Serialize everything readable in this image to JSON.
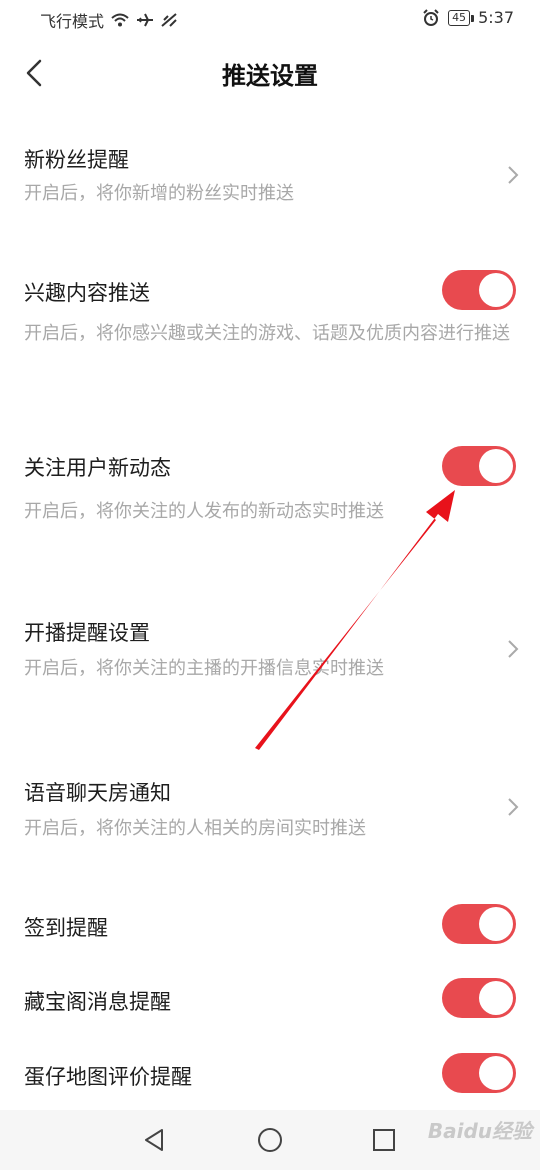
{
  "status_bar": {
    "left_text": "飞行模式",
    "battery": "45",
    "time": "5:37"
  },
  "header": {
    "title": "推送设置"
  },
  "settings": [
    {
      "title": "新粉丝提醒",
      "desc": "开启后，将你新增的粉丝实时推送",
      "control": "chevron"
    },
    {
      "title": "兴趣内容推送",
      "desc": "开启后，将你感兴趣或关注的游戏、话题及优质内容进行推送",
      "control": "toggle",
      "on": true
    },
    {
      "title": "关注用户新动态",
      "desc": "开启后，将你关注的人发布的新动态实时推送",
      "control": "toggle",
      "on": true
    },
    {
      "title": "开播提醒设置",
      "desc": "开启后，将你关注的主播的开播信息实时推送",
      "control": "chevron"
    },
    {
      "title": "语音聊天房通知",
      "desc": "开启后，将你关注的人相关的房间实时推送",
      "control": "chevron"
    },
    {
      "title": "签到提醒",
      "control": "toggle",
      "on": true
    },
    {
      "title": "藏宝阁消息提醒",
      "control": "toggle",
      "on": true
    },
    {
      "title": "蛋仔地图评价提醒",
      "control": "toggle",
      "on": true
    }
  ],
  "colors": {
    "toggle_on": "#e84a4f",
    "annotation_arrow": "#e8121b"
  },
  "watermark": "Baidu经验"
}
